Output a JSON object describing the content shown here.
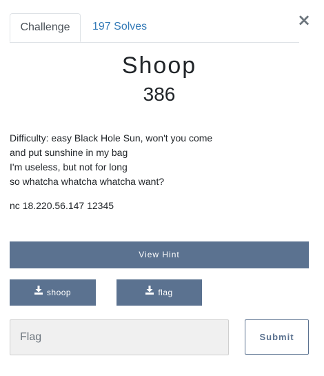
{
  "modal": {
    "close_symbol": "×"
  },
  "tabs": [
    {
      "label": "Challenge",
      "active": true
    },
    {
      "label": "197 Solves",
      "active": false
    }
  ],
  "challenge": {
    "name": "Shoop",
    "value": "386",
    "description_lines": [
      "Difficulty: easy Black Hole Sun, won't you come",
      "and put sunshine in my bag",
      "I'm useless, but not for long",
      "so whatcha whatcha whatcha want?"
    ],
    "connection": "nc 18.220.56.147 12345"
  },
  "hint_button": {
    "label": "View Hint"
  },
  "files": [
    {
      "label": "shoop",
      "icon": "download-icon"
    },
    {
      "label": "flag",
      "icon": "download-icon"
    }
  ],
  "flag_input": {
    "placeholder": "Flag",
    "value": ""
  },
  "submit_button": {
    "label": "Submit"
  },
  "colors": {
    "accent": "#5b7290",
    "link": "#337ab7",
    "input_bg": "#f0f0f0"
  }
}
